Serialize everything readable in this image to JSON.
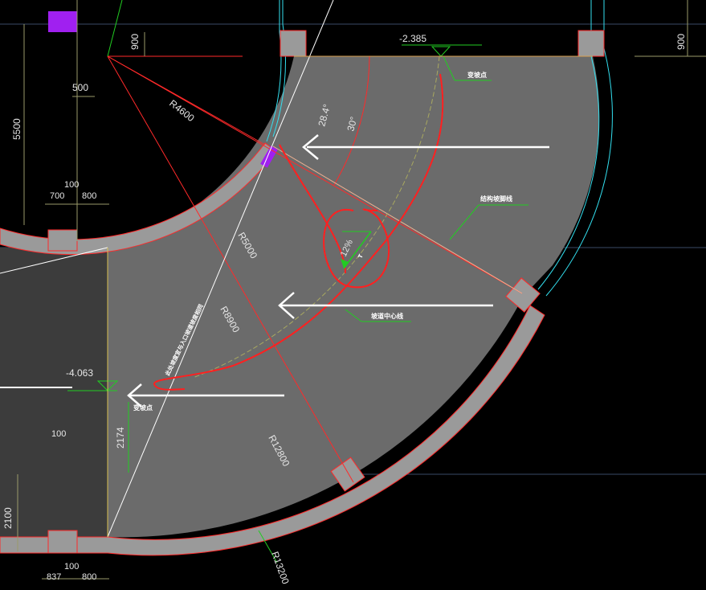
{
  "dimensions": {
    "top_left_900": "900",
    "top_right_900": "900",
    "offset_500": "500",
    "height_5500": "5500",
    "top_100": "100",
    "top_700": "700",
    "top_800": "800",
    "mid_100": "100",
    "left_2100": "2100",
    "bottom_100": "100",
    "bottom_837": "837",
    "bottom_800": "800",
    "height_2174": "2174"
  },
  "radii": {
    "r4600": "R4600",
    "r5000": "R5000",
    "r8900": "R8900",
    "r12800": "R12800",
    "r13200": "R13200"
  },
  "angles": {
    "angle_28_4": "28.4°",
    "angle_30": "30°",
    "slope": "12%"
  },
  "slope_marker": "T",
  "elevations": {
    "top": "-2.385",
    "left": "-4.063"
  },
  "annotations": {
    "change_point_top": "变坡点",
    "change_point_bottom": "变坡点",
    "structure_edge": "结构坡脚线",
    "lane_center": "坡道中心线",
    "vertical_note": "此处坡度宜与入口坡道坡度相同"
  },
  "colors": {
    "background": "#000000",
    "slab": "#6b6b6b",
    "dark_slab": "#3c3c3c",
    "wall": "#9a9a9a",
    "wall_edge": "#ff2a2a",
    "cyan": "#33e0f0",
    "green": "#22cc22",
    "yellow_green": "#c8c87a",
    "sketch_red": "#ff2020",
    "marker_purple": "#a020f0",
    "grid": "#3a4a66"
  }
}
